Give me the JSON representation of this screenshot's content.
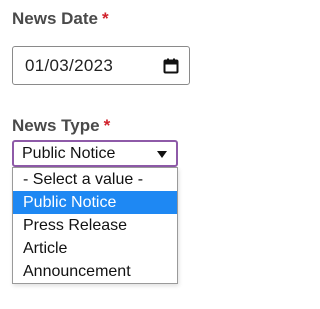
{
  "news_date": {
    "label": "News Date",
    "required_marker": "*",
    "value": "01/03/2023",
    "icon": "calendar-icon"
  },
  "news_type": {
    "label": "News Type",
    "required_marker": "*",
    "selected": "Public Notice",
    "options": [
      "- Select a value -",
      "Public Notice",
      "Press Release",
      "Article",
      "Announcement"
    ],
    "selected_index": 1
  },
  "colors": {
    "required": "#d0202a",
    "focus_border": "#8e5aa8",
    "option_highlight": "#1e88f3"
  }
}
